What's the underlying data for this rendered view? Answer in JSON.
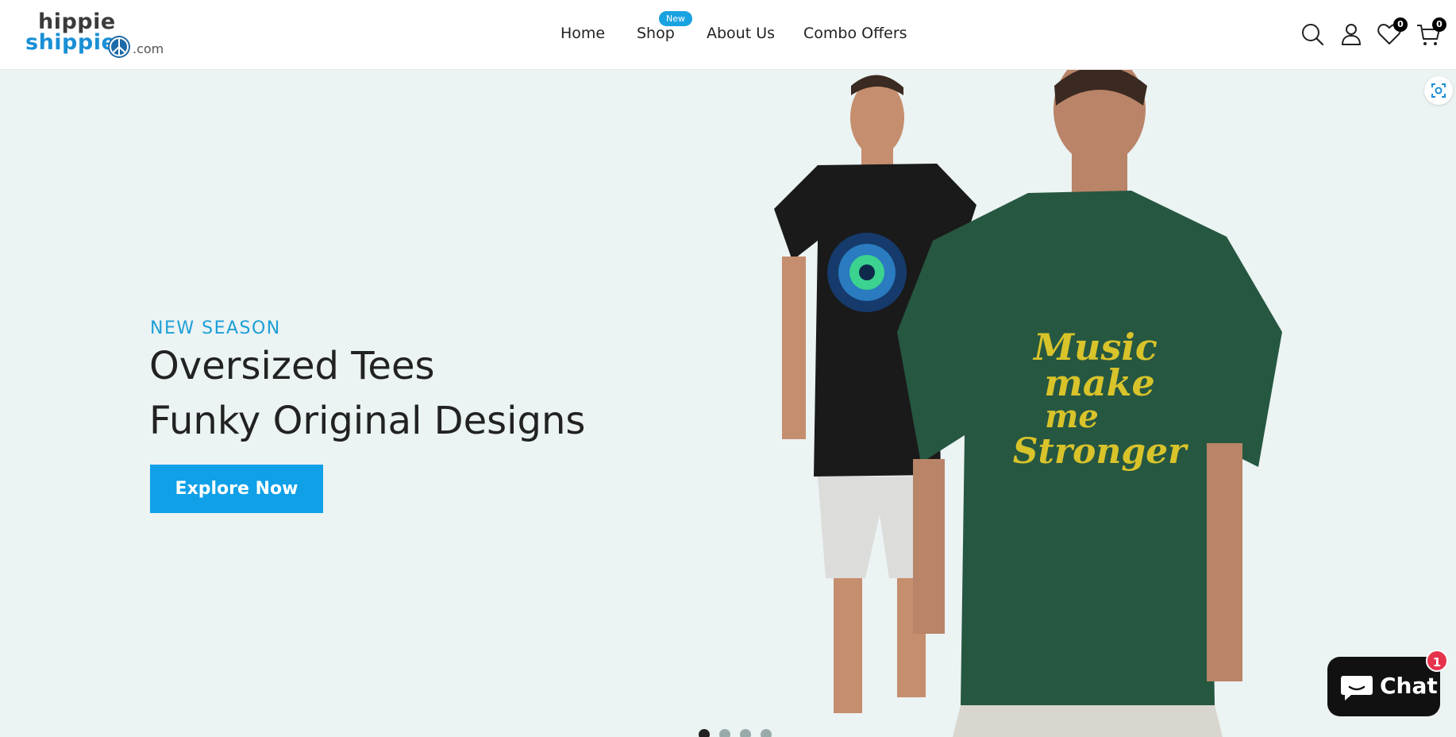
{
  "brand": {
    "line1": "hippie",
    "line2": "shippie",
    "suffix": ".com",
    "primary_color": "#1a8fd6"
  },
  "nav": {
    "items": [
      {
        "label": "Home"
      },
      {
        "label": "Shop",
        "badge": "New"
      },
      {
        "label": "About Us"
      },
      {
        "label": "Combo Offers"
      }
    ]
  },
  "header_icons": {
    "search": "search-icon",
    "account": "user-icon",
    "wishlist": {
      "icon": "heart-icon",
      "count": "0"
    },
    "cart": {
      "icon": "cart-icon",
      "count": "0"
    }
  },
  "hero": {
    "eyebrow": "NEW SEASON",
    "title_line1": "Oversized Tees",
    "title_line2": "Funky Original Designs",
    "cta_label": "Explore Now",
    "accent_color": "#0fa0e8",
    "background_color": "#ebf3f3",
    "tshirt_print": [
      "Music",
      "make",
      "me",
      "Stronger"
    ],
    "slides": {
      "count": 4,
      "active": 1
    }
  },
  "chat": {
    "label": "Chat",
    "unread": "1"
  }
}
